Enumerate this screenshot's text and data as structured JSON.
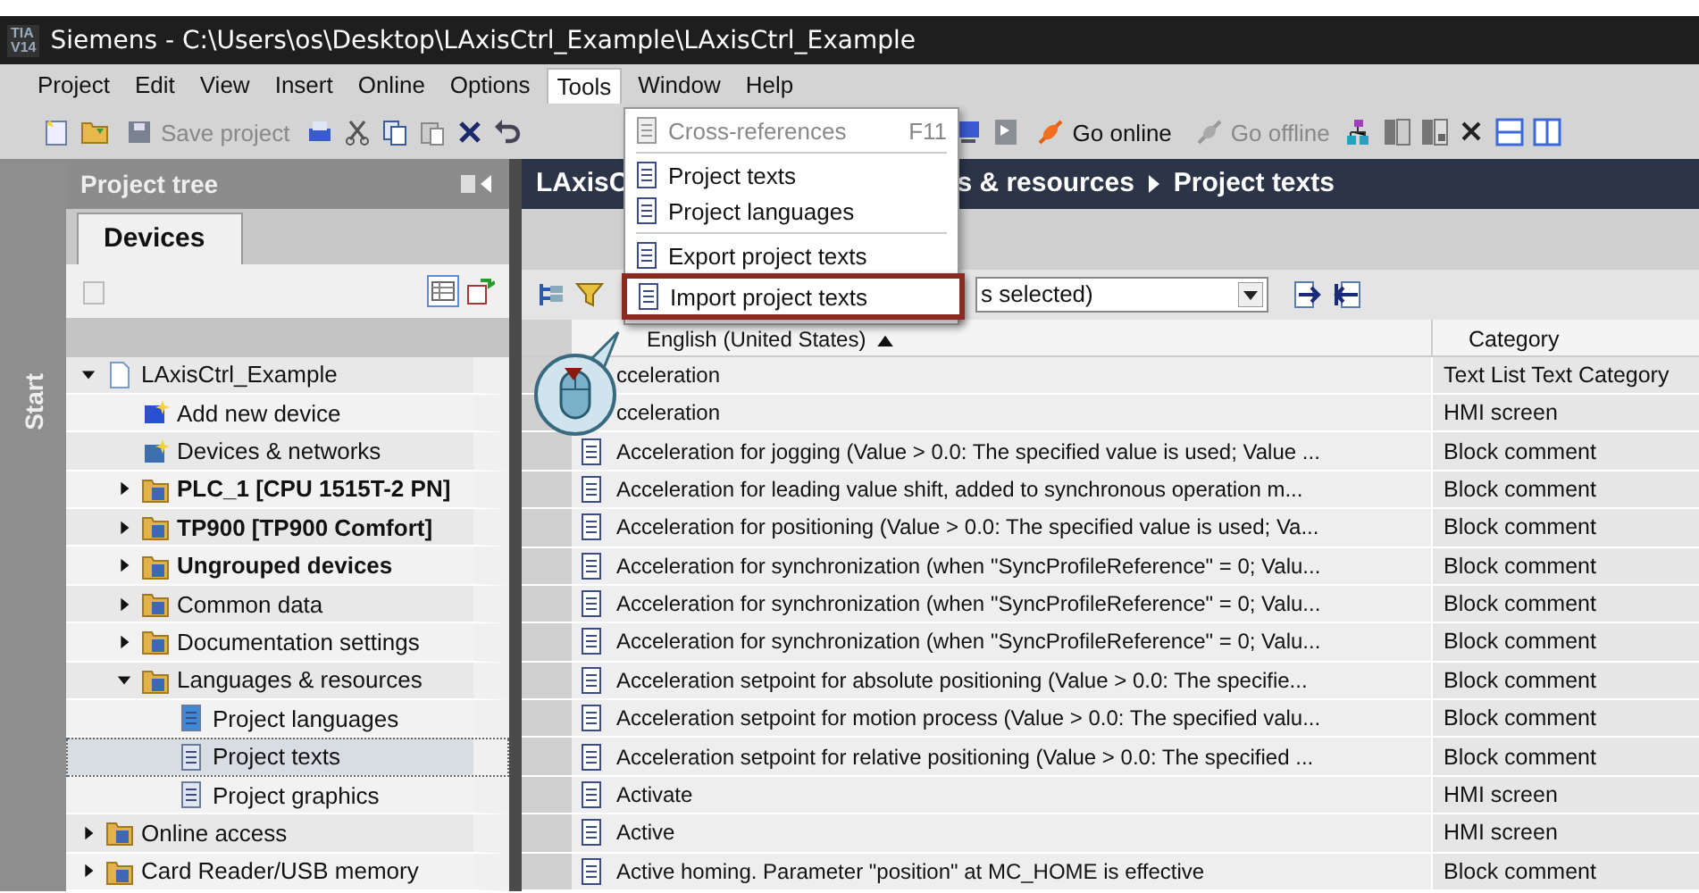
{
  "window": {
    "logo": [
      "TIA",
      "V14"
    ],
    "title": "Siemens - C:\\Users\\os\\Desktop\\LAxisCtrl_Example\\LAxisCtrl_Example"
  },
  "menu_bar": [
    {
      "label": "Project",
      "selected": false
    },
    {
      "label": "Edit",
      "selected": false
    },
    {
      "label": "View",
      "selected": false
    },
    {
      "label": "Insert",
      "selected": false
    },
    {
      "label": "Online",
      "selected": false
    },
    {
      "label": "Options",
      "selected": false
    },
    {
      "label": "Tools",
      "selected": true
    },
    {
      "label": "Window",
      "selected": false
    },
    {
      "label": "Help",
      "selected": false
    }
  ],
  "toolbar": {
    "save_label": "Save project",
    "go_online": "Go online",
    "go_offline": "Go offline"
  },
  "tools_menu": [
    {
      "kind": "item",
      "label": "Cross-references",
      "shortcut": "F11",
      "disabled": true,
      "highlighted": false
    },
    {
      "kind": "separator"
    },
    {
      "kind": "item",
      "label": "Project texts",
      "disabled": false,
      "highlighted": false
    },
    {
      "kind": "item",
      "label": "Project languages",
      "disabled": false,
      "highlighted": false
    },
    {
      "kind": "separator"
    },
    {
      "kind": "item",
      "label": "Export project texts",
      "disabled": false,
      "highlighted": false
    },
    {
      "kind": "item",
      "label": "Import project texts",
      "disabled": false,
      "highlighted": true
    }
  ],
  "start_strip": "Start",
  "project_tree": {
    "title": "Project tree",
    "tab": "Devices",
    "items": [
      {
        "label": "LAxisCtrl_Example",
        "kind": "project",
        "expanded": true,
        "bold": false,
        "selected": false,
        "children": [
          {
            "label": "Add new device",
            "kind": "add",
            "bold": false,
            "selected": false
          },
          {
            "label": "Devices & networks",
            "kind": "network",
            "bold": false,
            "selected": false
          },
          {
            "label": "PLC_1 [CPU 1515T-2 PN]",
            "kind": "plc",
            "expanded": false,
            "bold": true,
            "selected": false
          },
          {
            "label": "TP900 [TP900 Comfort]",
            "kind": "hmi",
            "expanded": false,
            "bold": true,
            "selected": false
          },
          {
            "label": "Ungrouped devices",
            "kind": "ungrouped",
            "expanded": false,
            "bold": true,
            "selected": false
          },
          {
            "label": "Common data",
            "kind": "common",
            "expanded": false,
            "bold": false,
            "selected": false
          },
          {
            "label": "Documentation settings",
            "kind": "docs",
            "expanded": false,
            "bold": false,
            "selected": false
          },
          {
            "label": "Languages & resources",
            "kind": "globe",
            "expanded": true,
            "bold": false,
            "selected": false,
            "children": [
              {
                "label": "Project languages",
                "kind": "languages",
                "bold": false,
                "selected": false
              },
              {
                "label": "Project texts",
                "kind": "texts",
                "bold": false,
                "selected": true
              },
              {
                "label": "Project graphics",
                "kind": "graphics",
                "bold": false,
                "selected": false
              }
            ]
          }
        ]
      },
      {
        "label": "Online access",
        "kind": "online",
        "expanded": false,
        "bold": false,
        "selected": false
      },
      {
        "label": "Card Reader/USB memory",
        "kind": "card",
        "expanded": false,
        "bold": false,
        "selected": false
      }
    ]
  },
  "editor": {
    "breadcrumb": [
      "LAxisC",
      "s & resources",
      "Project texts"
    ],
    "filter_value": "s selected)",
    "table": {
      "columns": [
        "English (United States)",
        "Category"
      ],
      "rows": [
        {
          "text": "cceleration",
          "category": "Text List Text Category"
        },
        {
          "text": "cceleration",
          "category": "HMI screen"
        },
        {
          "text": "Acceleration for jogging (Value > 0.0: The specified value is used; Value ...",
          "category": "Block comment"
        },
        {
          "text": "Acceleration for leading value shift, added to synchronous operation m...",
          "category": "Block comment"
        },
        {
          "text": "Acceleration for positioning (Value > 0.0: The specified value is used; Va...",
          "category": "Block comment"
        },
        {
          "text": "Acceleration for synchronization (when \"SyncProfileReference\" = 0; Valu...",
          "category": "Block comment"
        },
        {
          "text": "Acceleration for synchronization (when \"SyncProfileReference\" = 0; Valu...",
          "category": "Block comment"
        },
        {
          "text": "Acceleration for synchronization (when \"SyncProfileReference\" = 0; Valu...",
          "category": "Block comment"
        },
        {
          "text": "Acceleration setpoint for absolute positioning (Value > 0.0: The specifie...",
          "category": "Block comment"
        },
        {
          "text": "Acceleration setpoint for motion process (Value > 0.0: The specified valu...",
          "category": "Block comment"
        },
        {
          "text": "Acceleration setpoint for relative positioning (Value > 0.0: The specified ...",
          "category": "Block comment"
        },
        {
          "text": "Activate",
          "category": "HMI screen"
        },
        {
          "text": "Active",
          "category": "HMI screen"
        },
        {
          "text": "Active homing. Parameter \"position\" at MC_HOME is effective",
          "category": "Block comment"
        }
      ]
    }
  }
}
